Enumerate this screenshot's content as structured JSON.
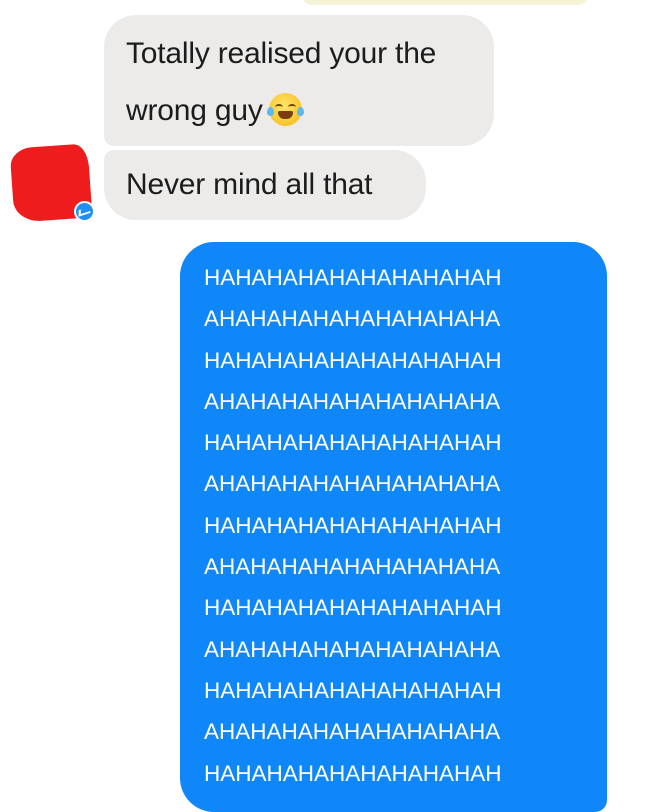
{
  "conversation": {
    "incoming": {
      "first_message": {
        "line1": "Totally realised your the",
        "line2": "wrong guy"
      },
      "emoji": "face-with-tears-of-joy",
      "second_message": "Never mind all that"
    },
    "outgoing": {
      "lines": [
        "HAHAHAHAHAHAHAHAHAH",
        "AHAHAHAHAHAHAHAHAHA",
        "HAHAHAHAHAHAHAHAHAH",
        "AHAHAHAHAHAHAHAHAHA",
        "HAHAHAHAHAHAHAHAHAH",
        "AHAHAHAHAHAHAHAHAHA",
        "HAHAHAHAHAHAHAHAHAH",
        "AHAHAHAHAHAHAHAHAHA",
        "HAHAHAHAHAHAHAHAHAH",
        "AHAHAHAHAHAHAHAHAHA",
        "HAHAHAHAHAHAHAHAHAH",
        "AHAHAHAHAHAHAHAHAHA",
        "HAHAHAHAHAHAHAHAHAH"
      ]
    }
  },
  "colors": {
    "incoming_bubble": "#ecebea",
    "outgoing_bubble": "#0f87f8",
    "avatar_redaction": "#ee1c1c",
    "messenger_badge": "#1e90f5"
  }
}
